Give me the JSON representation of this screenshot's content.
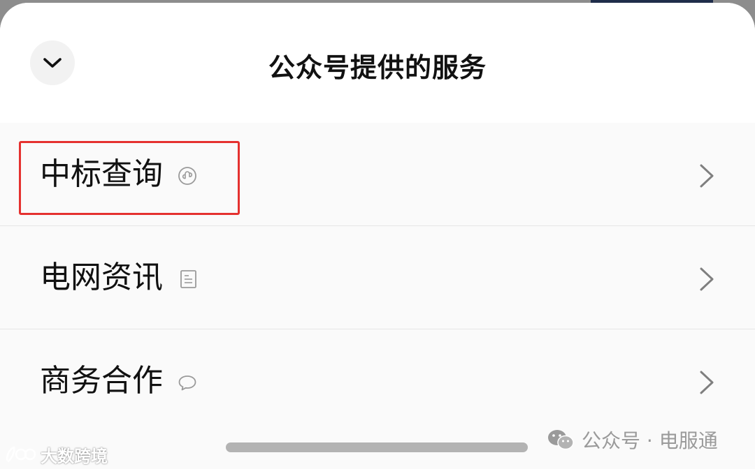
{
  "sheet": {
    "title": "公众号提供的服务",
    "collapse_icon": "chevron-down-icon"
  },
  "services": [
    {
      "label": "中标查询",
      "type_icon": "mini-program-icon",
      "highlighted": true
    },
    {
      "label": "电网资讯",
      "type_icon": "article-icon",
      "highlighted": false
    },
    {
      "label": "商务合作",
      "type_icon": "message-bubble-icon",
      "highlighted": false
    }
  ],
  "watermarks": {
    "right": "公众号 · 电服通",
    "left": "大数跨境"
  },
  "colors": {
    "highlight_border": "#e5312f",
    "sheet_background": "#ffffff",
    "list_background": "#fafafa"
  }
}
